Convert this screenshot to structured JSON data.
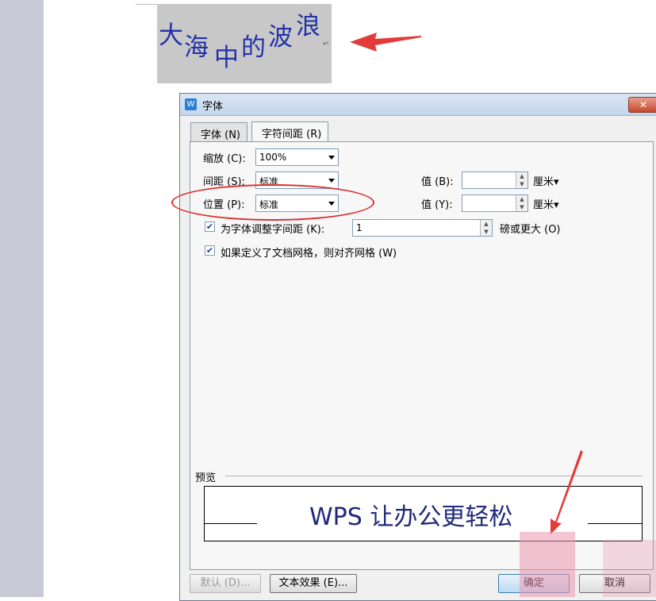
{
  "document": {
    "selected_text_chars": [
      "大",
      "海",
      "中",
      "的",
      "波",
      "浪"
    ],
    "paragraph_mark": "↵"
  },
  "dialog": {
    "title": "字体",
    "close_label": "✕",
    "tabs": [
      {
        "label": "字体 (N)",
        "active": false
      },
      {
        "label": "字符间距 (R)",
        "active": true
      }
    ],
    "scale": {
      "label": "缩放 (C):",
      "value": "100%"
    },
    "spacing": {
      "label": "间距 (S):",
      "value": "标准",
      "value_label": "值 (B):",
      "amount": "",
      "unit": "厘米▾"
    },
    "position": {
      "label": "位置 (P):",
      "value": "标准",
      "value_label": "值 (Y):",
      "amount": "",
      "unit": "厘米▾"
    },
    "kerning": {
      "checked": true,
      "label": "为字体调整字间距 (K):",
      "value": "1",
      "suffix": "磅或更大 (O)"
    },
    "snap_grid": {
      "checked": true,
      "label": "如果定义了文档网格，则对齐网格 (W)"
    },
    "preview": {
      "label": "预览",
      "sample_text": "WPS 让办公更轻松"
    },
    "buttons": {
      "default": "默认 (D)...",
      "text_effects": "文本效果 (E)...",
      "ok": "确定",
      "cancel": "取消"
    }
  },
  "colors": {
    "annotation_red": "#d93030",
    "doc_text_blue": "#2431a8",
    "preview_text": "#21297a"
  }
}
